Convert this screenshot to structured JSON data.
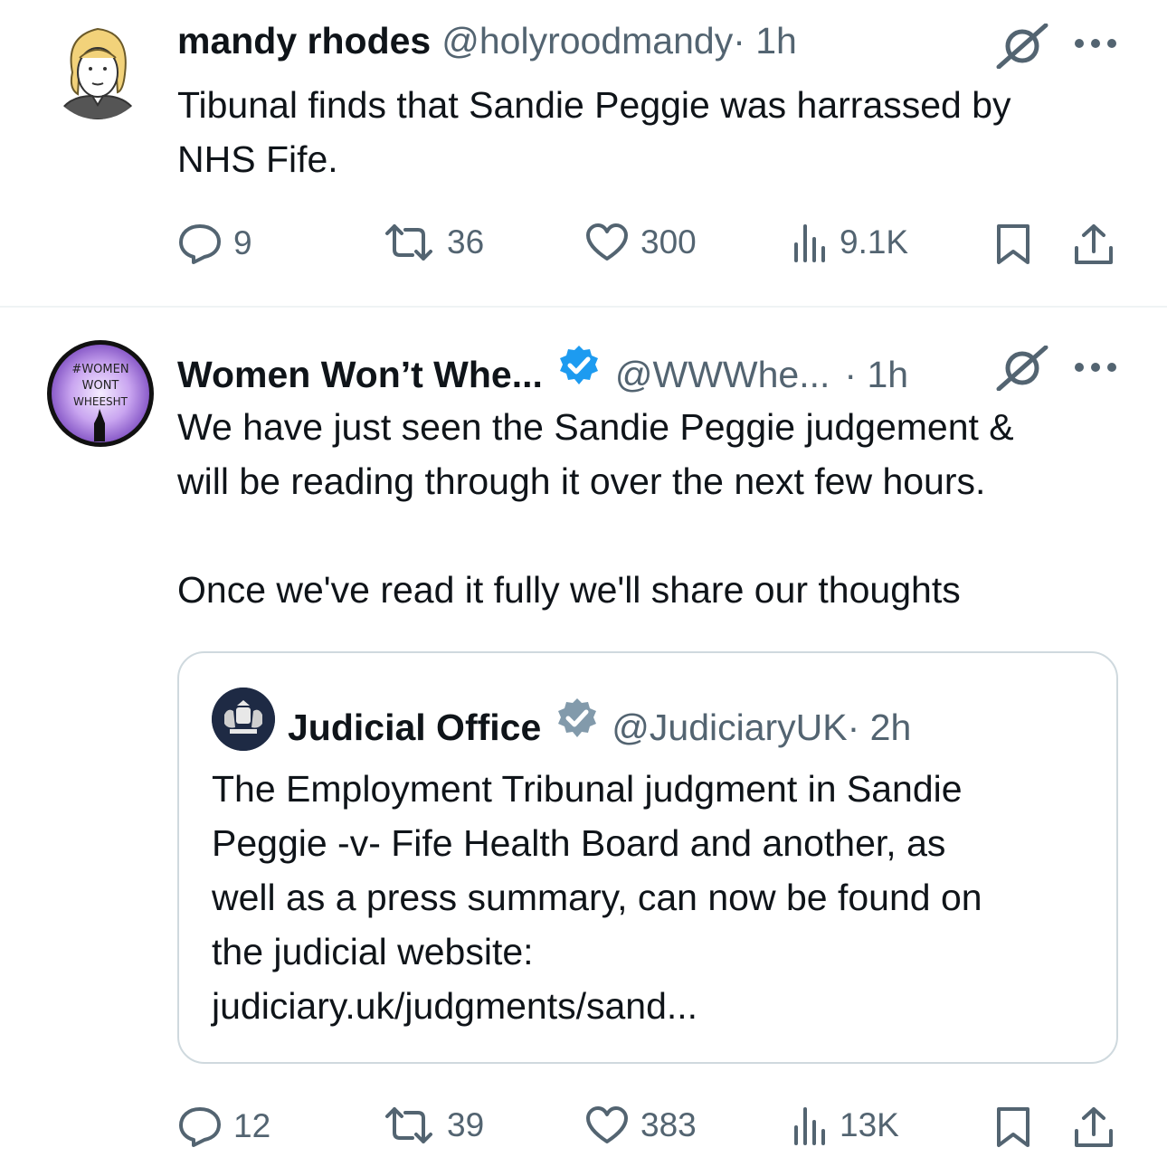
{
  "tweets": [
    {
      "author_name": "mandy rhodes",
      "handle": "@holyroodmandy",
      "time": " · 1h",
      "text": "Tibunal finds that Sandie Peggie was harrassed by\nNHS Fife.",
      "replies": "9",
      "reposts": "36",
      "likes": "300",
      "views": "9.1K"
    },
    {
      "author_name": "Women Won’t Whe...",
      "handle": "@WWWhe...",
      "time": " · 1h",
      "avatar_text": [
        "#WOMEN",
        "WONT",
        "WHEESHT"
      ],
      "text": "We have just seen the Sandie Peggie judgement &\nwill be reading through it over the next few hours.\n\nOnce we've read it fully we'll share our thoughts",
      "replies": "12",
      "reposts": "39",
      "likes": "383",
      "views": "13K",
      "quote": {
        "author_name": "Judicial Office",
        "handle": "@JudiciaryUK",
        "time": " · 2h",
        "text": "The Employment Tribunal judgment in Sandie\nPeggie -v- Fife Health Board and another, as\nwell as a press summary, can now be found on\nthe judicial website:\njudiciary.uk/judgments/sand..."
      }
    }
  ],
  "icons": {
    "grok": "grok-icon",
    "more": "more-icon",
    "reply": "reply-icon",
    "repost": "repost-icon",
    "like": "heart-icon",
    "views": "views-icon",
    "bookmark": "bookmark-icon",
    "share": "share-icon"
  },
  "colors": {
    "text": "#0f1419",
    "secondary": "#536471",
    "verified_blue": "#1d9bf0",
    "verified_gray": "#829aab",
    "border": "#cfd9de"
  }
}
